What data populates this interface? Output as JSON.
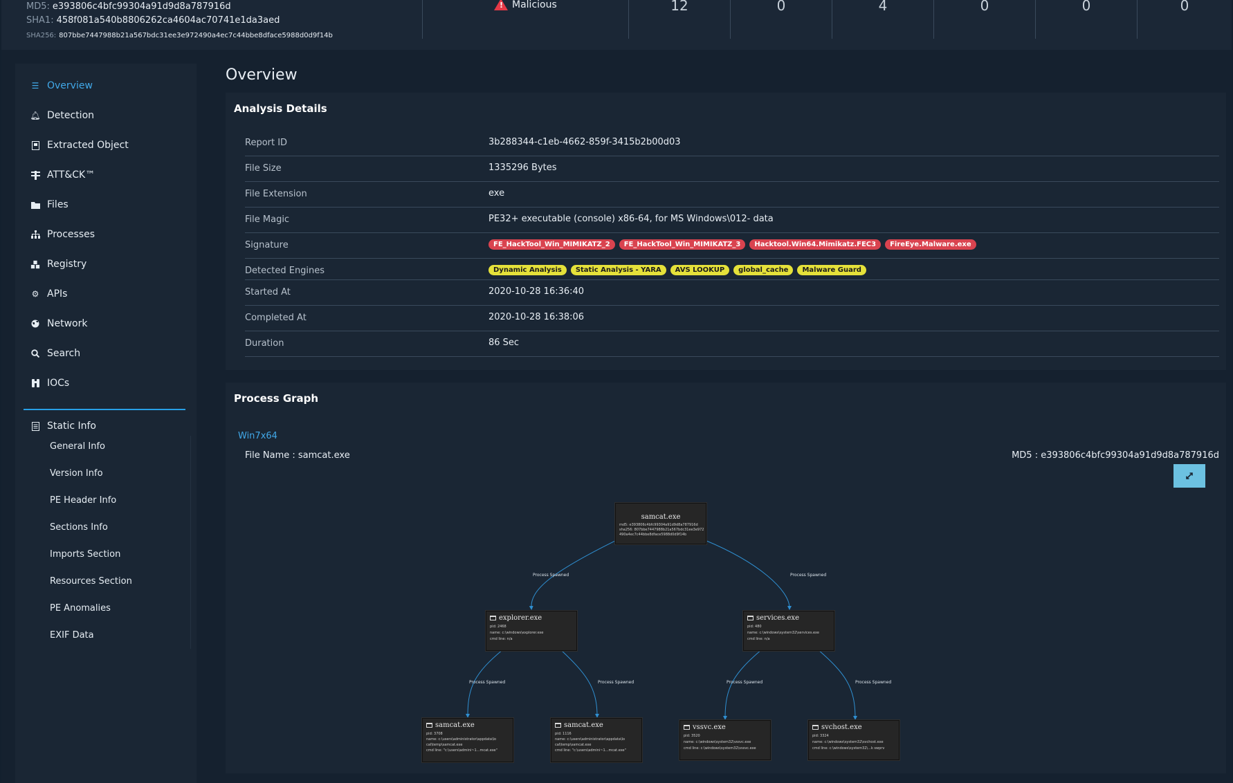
{
  "header": {
    "md5_label": "MD5:",
    "md5": "e393806c4bfc99304a91d9d8a787916d",
    "sha1_label": "SHA1:",
    "sha1": "458f081a540b8806262ca4604ac70741e1da3aed",
    "sha256_label": "SHA256:",
    "sha256": "807bbe7447988b21a567bdc31ee3e972490a4ec7c44bbe8dface5988d0d9f14b",
    "verdict": "Malicious",
    "stats": [
      "12",
      "0",
      "4",
      "0",
      "0",
      "0"
    ]
  },
  "sidebar": {
    "items": [
      {
        "label": "Overview",
        "icon": "list-icon"
      },
      {
        "label": "Detection",
        "icon": "bell-icon"
      },
      {
        "label": "Extracted Object",
        "icon": "document-icon"
      },
      {
        "label": "ATT&CK™",
        "icon": "filter-icon"
      },
      {
        "label": "Files",
        "icon": "folder-icon"
      },
      {
        "label": "Processes",
        "icon": "sitemap-icon"
      },
      {
        "label": "Registry",
        "icon": "cubes-icon"
      },
      {
        "label": "APIs",
        "icon": "cogs-icon"
      },
      {
        "label": "Network",
        "icon": "globe-icon"
      },
      {
        "label": "Search",
        "icon": "search-icon"
      },
      {
        "label": "IOCs",
        "icon": "binoculars-icon"
      }
    ],
    "static_info_label": "Static Info",
    "static_sub": [
      "General Info",
      "Version Info",
      "PE Header Info",
      "Sections Info",
      "Imports Section",
      "Resources Section",
      "PE Anomalies",
      "EXIF Data"
    ]
  },
  "main": {
    "title": "Overview",
    "analysis": {
      "title": "Analysis Details",
      "rows": [
        {
          "label": "Report ID",
          "value": "3b288344-c1eb-4662-859f-3415b2b00d03"
        },
        {
          "label": "File Size",
          "value": "1335296 Bytes"
        },
        {
          "label": "File Extension",
          "value": "exe"
        },
        {
          "label": "File Magic",
          "value": "PE32+ executable (console) x86-64, for MS Windows\\012- data"
        },
        {
          "label": "Signature"
        },
        {
          "label": "Detected Engines"
        },
        {
          "label": "Started At",
          "value": "2020-10-28 16:36:40"
        },
        {
          "label": "Completed At",
          "value": "2020-10-28 16:38:06"
        },
        {
          "label": "Duration",
          "value": "86 Sec"
        }
      ],
      "signatures": [
        "FE_HackTool_Win_MIMIKATZ_2",
        "FE_HackTool_Win_MIMIKATZ_3",
        "Hacktool.Win64.Mimikatz.FEC3",
        "FireEye.Malware.exe"
      ],
      "engines": [
        "Dynamic Analysis",
        "Static Analysis - YARA",
        "AVS LOOKUP",
        "global_cache",
        "Malware Guard"
      ]
    },
    "graph": {
      "title": "Process Graph",
      "os": "Win7x64",
      "file_name": "File Name : samcat.exe",
      "md5": "MD5 : e393806c4bfc99304a91d9d8a787916d",
      "edge_label": "Process Spawned",
      "nodes": [
        {
          "name": "samcat.exe",
          "lines": [
            "md5: e393806c4bfc99304a91d9d8a787916d",
            "sha256: 807bbe7447988b21a567bdc31ee3e972",
            "490a4ec7c44bbe8dface5988d0d9f14b"
          ]
        },
        {
          "name": "explorer.exe",
          "lines": [
            "pid: 2468",
            "name: c:\\windows\\explorer.exe",
            "cmd line: n/a"
          ]
        },
        {
          "name": "services.exe",
          "lines": [
            "pid: 480",
            "name: c:\\windows\\system32\\services.exe",
            "cmd line: n/a"
          ]
        },
        {
          "name": "samcat.exe",
          "lines": [
            "pid: 3708",
            "name: c:\\users\\administrator\\appdata\\lo",
            "cal\\temp\\samcat.exe",
            "cmd line: \"c:\\users\\admini~1...mcat.exe\""
          ]
        },
        {
          "name": "samcat.exe",
          "lines": [
            "pid: 1116",
            "name: c:\\users\\administrator\\appdata\\lo",
            "cal\\temp\\samcat.exe",
            "cmd line: \"c:\\users\\admini~1...mcat.exe\""
          ]
        },
        {
          "name": "vssvc.exe",
          "lines": [
            "pid: 3520",
            "name: c:\\windows\\system32\\vssvc.exe",
            "cmd line: c:\\windows\\system32\\vssvc.exe"
          ]
        },
        {
          "name": "svchost.exe",
          "lines": [
            "pid: 3324",
            "name: c:\\windows\\system32\\svchost.exe",
            "cmd line: c:\\windows\\system32\\...k swprv"
          ]
        }
      ]
    }
  },
  "colors": {
    "accent": "#41a8e8",
    "danger": "#d9434f",
    "warning": "#e5e13a",
    "button": "#6cc1e1"
  }
}
